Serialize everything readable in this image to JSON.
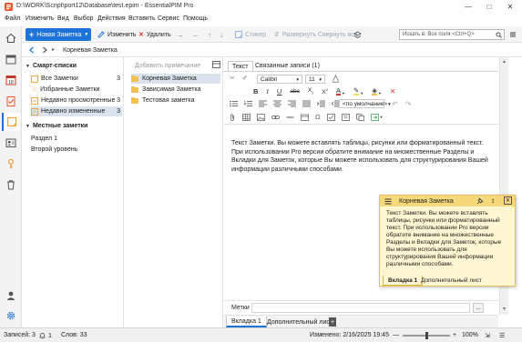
{
  "window": {
    "title": "D:\\WORK\\Script\\port12\\Database\\test.epim - EssentialPIM Pro"
  },
  "menu": [
    "Файл",
    "Изменить",
    "Вид",
    "Выбор",
    "Действия",
    "Вставить",
    "Сервис",
    "Помощь"
  ],
  "toolbar": {
    "new_note": "Новая Заметка",
    "edit": "Изменить",
    "delete": "Удалить",
    "sticker": "Стикер",
    "expand_collapse": "Развернуть Свернуть все",
    "search_placeholder": "Искать в: Все поля",
    "search_shortcut": "<Ctrl+Q>"
  },
  "path": "Корневая Заметка",
  "sidebar": {
    "smart_title": "Смарт-списки",
    "smart_items": [
      {
        "label": "Все Заметки",
        "count": "3"
      },
      {
        "label": "Избранные Заметки",
        "count": ""
      },
      {
        "label": "Недавно просмотренные",
        "count": "3"
      },
      {
        "label": "Недавно измененные",
        "count": "3"
      }
    ],
    "local_title": "Местные заметки",
    "local_items": [
      {
        "label": "Раздел 1"
      },
      {
        "label": "Второй уровень"
      }
    ]
  },
  "notes_list": {
    "add_placeholder": "Добавить примечание",
    "items": [
      {
        "label": "Корневая Заметка"
      },
      {
        "label": "Зависимая Заметка"
      },
      {
        "label": "Тестовая заметка"
      }
    ]
  },
  "editor": {
    "tabs": [
      {
        "label": "Текст"
      },
      {
        "label": "Связанные записи (1)"
      }
    ],
    "font": "Calibri",
    "font_size": "11",
    "style": "<по умолчание>",
    "text": "Текст Заметки. Вы можете вставлять таблицы, рисунки или форматированный текст. При использовании Pro версии обратите внимание на множественные Разделы и Вкладки для Заметок, которые Вы можете использовать для структурирования Вашей информации различными способами.",
    "labels_label": "Метки",
    "labels_button": "...",
    "bottom_tabs": [
      {
        "label": "Вкладка 1"
      },
      {
        "label": "Дополнительный лист"
      }
    ],
    "add_tab": "+"
  },
  "popup": {
    "title": "Корневая Заметка",
    "text": "Текст Заметки. Вы можете вставлять таблицы, рисунки или форматированный текст. При использовании Pro версии обратите внимание на множественные Разделы и Вкладки для Заметок, которые Вы можете использовать для структурирования Вашей информации различными способами.",
    "tabs": [
      {
        "label": "Вкладка 1"
      },
      {
        "label": "Дополнительный лист"
      }
    ]
  },
  "status": {
    "selected": "Записей: 3",
    "count": "1",
    "words": "Слов: 33",
    "modified": "Изменено: 2/16/2025 19:45",
    "zoom": "100%",
    "zoom_level": 0.5
  },
  "colors": {
    "accent": "#1e73d8",
    "selection": "#dbe3ee",
    "popup_bg": "#fff6d2",
    "popup_header": "#f5d97a"
  }
}
